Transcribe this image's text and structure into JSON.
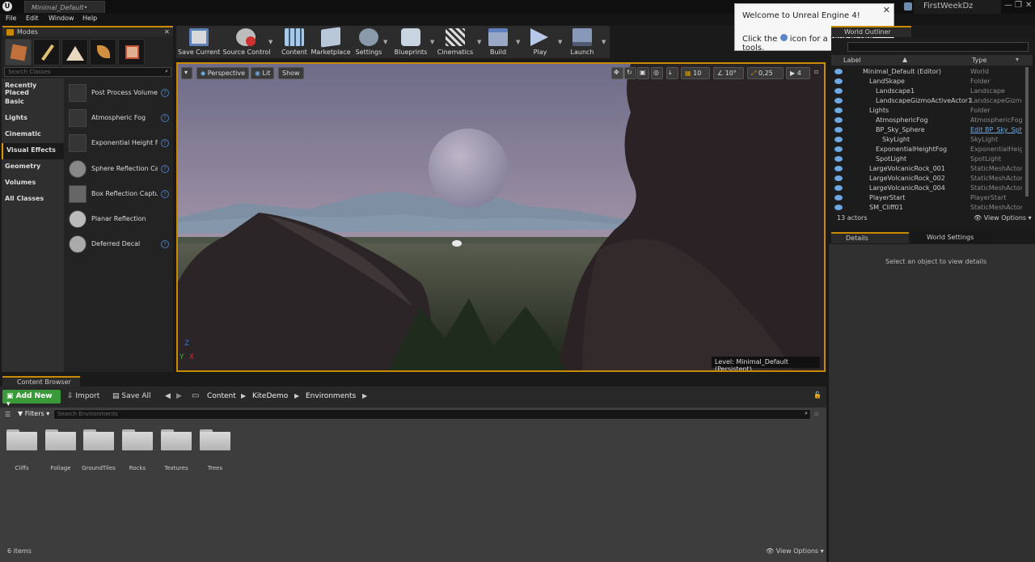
{
  "title_bar": {
    "doc_tab": "Minimal_Default•",
    "project": "FirstWeekDz",
    "min": "—",
    "max": "❐",
    "close": "✕"
  },
  "menu": [
    "File",
    "Edit",
    "Window",
    "Help"
  ],
  "modes": {
    "tab_label": "Modes",
    "search_placeholder": "Search Classes",
    "categories": [
      "Recently Placed",
      "Basic",
      "Lights",
      "Cinematic",
      "Visual Effects",
      "Geometry",
      "Volumes",
      "All Classes"
    ],
    "selected_category": "Visual Effects",
    "items": [
      "Post Process Volume",
      "Atmospheric Fog",
      "Exponential Height Fo",
      "Sphere Reflection Caj",
      "Box Reflection Captur",
      "Planar Reflection",
      "Deferred Decal"
    ]
  },
  "toolbar": [
    {
      "label": "Save Current",
      "icon": "save-icon"
    },
    {
      "label": "Source Control",
      "icon": "source-control-icon"
    },
    {
      "label": "Content",
      "icon": "content-icon"
    },
    {
      "label": "Marketplace",
      "icon": "marketplace-icon"
    },
    {
      "label": "Settings",
      "icon": "settings-icon"
    },
    {
      "label": "Blueprints",
      "icon": "blueprints-icon"
    },
    {
      "label": "Cinematics",
      "icon": "cinematics-icon"
    },
    {
      "label": "Build",
      "icon": "build-icon"
    },
    {
      "label": "Play",
      "icon": "play-icon"
    },
    {
      "label": "Launch",
      "icon": "launch-icon"
    }
  ],
  "popup": {
    "line1": "Welcome to Unreal Engine 4!",
    "line2a": "Click the",
    "line2b": "icon for a tour of the tools.",
    "close": "✕"
  },
  "viewport": {
    "perspective": "Perspective",
    "lit": "Lit",
    "show": "Show",
    "grid": "10",
    "angle": "10°",
    "scale": "0,25",
    "cam_speed": "4",
    "level": "Level:  Minimal_Default (Persistent)"
  },
  "outliner": {
    "tab_label": "World Outliner",
    "col_label": "Label",
    "col_type": "Type",
    "rows": [
      {
        "label": "Minimal_Default (Editor)",
        "type": "World",
        "indent": 0
      },
      {
        "label": "LandSkape",
        "type": "Folder",
        "indent": 1
      },
      {
        "label": "Landscape1",
        "type": "Landscape",
        "indent": 2
      },
      {
        "label": "LandscapeGizmoActiveActor1",
        "type": "LandscapeGizmo",
        "indent": 2
      },
      {
        "label": "Lights",
        "type": "Folder",
        "indent": 1
      },
      {
        "label": "AtmosphericFog",
        "type": "AtmosphericFog",
        "indent": 2
      },
      {
        "label": "BP_Sky_Sphere",
        "type": "Edit BP_Sky_Sph",
        "indent": 2
      },
      {
        "label": "SkyLight",
        "type": "SkyLight",
        "indent": 3
      },
      {
        "label": "ExponentialHeightFog",
        "type": "ExponentialHeigh",
        "indent": 2
      },
      {
        "label": "SpotLight",
        "type": "SpotLight",
        "indent": 2
      },
      {
        "label": "LargeVolcanicRock_001",
        "type": "StaticMeshActor",
        "indent": 1
      },
      {
        "label": "LargeVolcanicRock_002",
        "type": "StaticMeshActor",
        "indent": 1
      },
      {
        "label": "LargeVolcanicRock_004",
        "type": "StaticMeshActor",
        "indent": 1
      },
      {
        "label": "PlayerStart",
        "type": "PlayerStart",
        "indent": 1
      },
      {
        "label": "SM_Cliff01",
        "type": "StaticMeshActor",
        "indent": 1
      }
    ],
    "count": "13 actors",
    "view_options": "View Options"
  },
  "details": {
    "tab_label": "Details",
    "ws_tab_label": "World Settings",
    "empty": "Select an object to view details"
  },
  "content_browser": {
    "tab_label": "Content Browser",
    "add_new": "Add New",
    "import": "Import",
    "save_all": "Save All",
    "path": [
      "Content",
      "KiteDemo",
      "Environments"
    ],
    "filters": "Filters",
    "search_placeholder": "Search Environments",
    "folders": [
      "Cliffs",
      "Foliage",
      "GroundTiles",
      "Rocks",
      "Textures",
      "Trees"
    ],
    "count": "6 items",
    "view_options": "View Options"
  }
}
